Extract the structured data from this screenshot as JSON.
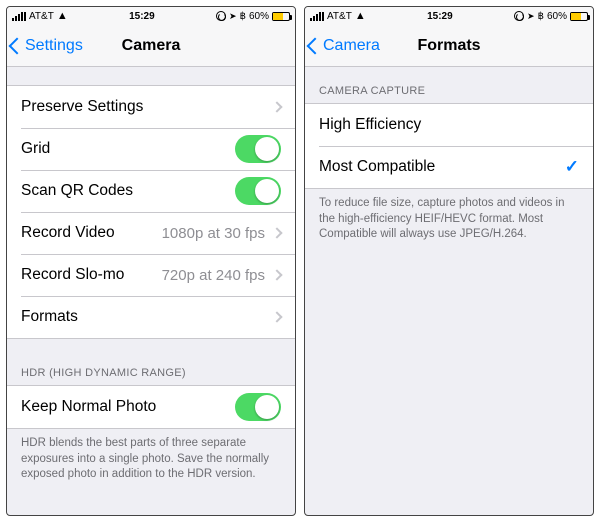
{
  "status": {
    "carrier": "AT&T",
    "time": "15:29",
    "battery_pct": "60%"
  },
  "left": {
    "back": "Settings",
    "title": "Camera",
    "rows": {
      "preserve": "Preserve Settings",
      "grid": "Grid",
      "scan_qr": "Scan QR Codes",
      "record_video": "Record Video",
      "record_video_detail": "1080p at 30 fps",
      "record_slomo": "Record Slo-mo",
      "record_slomo_detail": "720p at 240 fps",
      "formats": "Formats"
    },
    "hdr_header": "HDR (HIGH DYNAMIC RANGE)",
    "hdr_row": "Keep Normal Photo",
    "hdr_footer": "HDR blends the best parts of three separate exposures into a single photo. Save the normally exposed photo in addition to the HDR version.",
    "toggles": {
      "grid": true,
      "scan_qr": true,
      "keep_normal": true
    }
  },
  "right": {
    "back": "Camera",
    "title": "Formats",
    "section_header": "CAMERA CAPTURE",
    "rows": {
      "high_eff": "High Efficiency",
      "most_compat": "Most Compatible"
    },
    "selected": "most_compat",
    "footer": "To reduce file size, capture photos and videos in the high-efficiency HEIF/HEVC format. Most Compatible will always use JPEG/H.264."
  }
}
